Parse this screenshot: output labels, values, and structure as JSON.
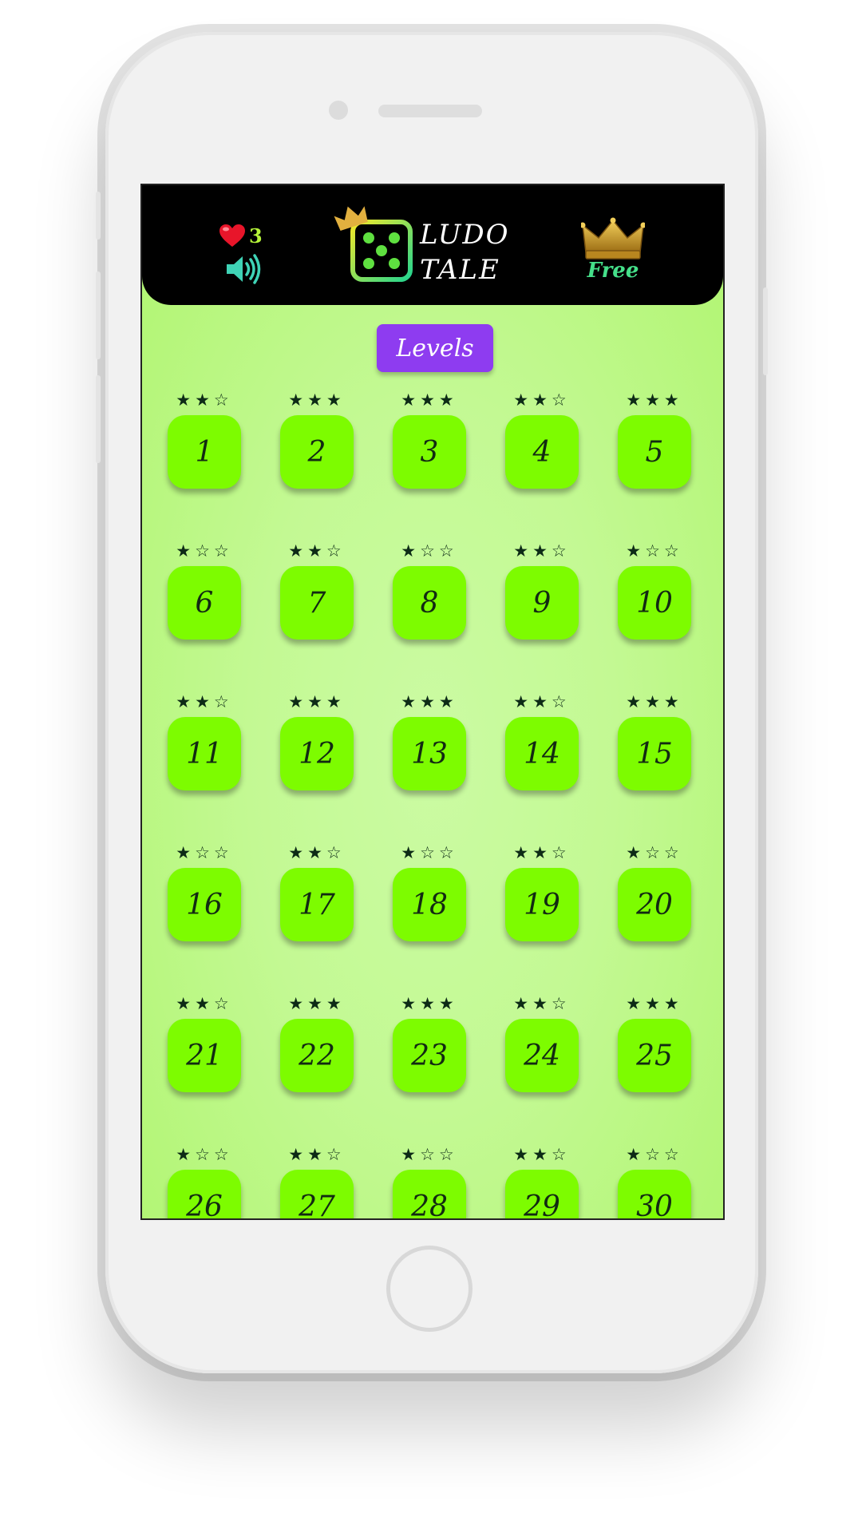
{
  "header": {
    "lives": "3",
    "logo_line1": "LUDO",
    "logo_line2": "TALE",
    "premium_label": "Free"
  },
  "levels_button": "Levels",
  "levels": [
    {
      "number": "1",
      "stars": 2
    },
    {
      "number": "2",
      "stars": 3
    },
    {
      "number": "3",
      "stars": 3
    },
    {
      "number": "4",
      "stars": 2
    },
    {
      "number": "5",
      "stars": 3
    },
    {
      "number": "6",
      "stars": 1
    },
    {
      "number": "7",
      "stars": 2
    },
    {
      "number": "8",
      "stars": 1
    },
    {
      "number": "9",
      "stars": 2
    },
    {
      "number": "10",
      "stars": 1
    },
    {
      "number": "11",
      "stars": 2
    },
    {
      "number": "12",
      "stars": 3
    },
    {
      "number": "13",
      "stars": 3
    },
    {
      "number": "14",
      "stars": 2
    },
    {
      "number": "15",
      "stars": 3
    },
    {
      "number": "16",
      "stars": 1
    },
    {
      "number": "17",
      "stars": 2
    },
    {
      "number": "18",
      "stars": 1
    },
    {
      "number": "19",
      "stars": 2
    },
    {
      "number": "20",
      "stars": 1
    },
    {
      "number": "21",
      "stars": 2
    },
    {
      "number": "22",
      "stars": 3
    },
    {
      "number": "23",
      "stars": 3
    },
    {
      "number": "24",
      "stars": 2
    },
    {
      "number": "25",
      "stars": 3
    },
    {
      "number": "26",
      "stars": 1
    },
    {
      "number": "27",
      "stars": 2
    },
    {
      "number": "28",
      "stars": 1
    },
    {
      "number": "29",
      "stars": 2
    },
    {
      "number": "30",
      "stars": 1
    }
  ],
  "colors": {
    "level_button": "#7dfc00",
    "levels_button": "#8e3cf0",
    "header": "#000000",
    "premium_label": "#45e08a"
  },
  "icons": [
    "heart-icon",
    "speaker-icon",
    "dice-icon",
    "crown-icon"
  ]
}
